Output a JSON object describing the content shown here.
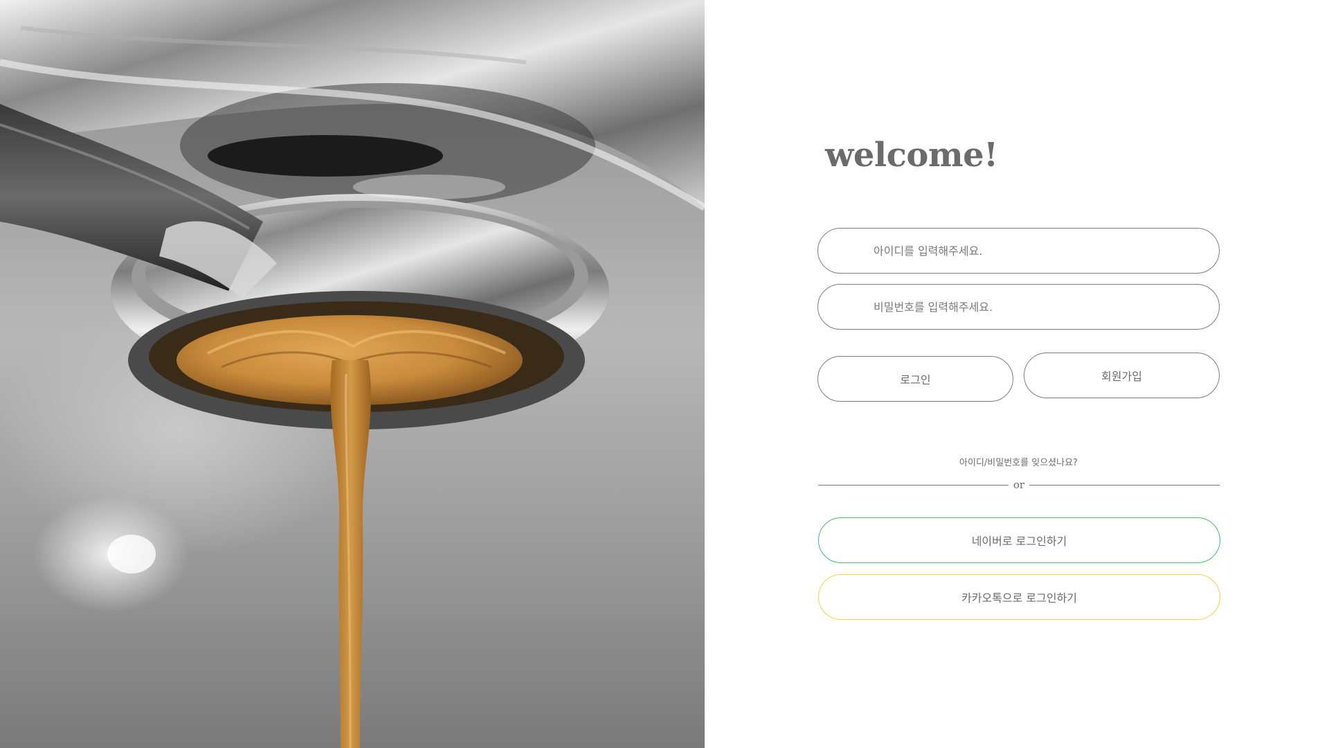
{
  "login": {
    "title": "welcome!",
    "id_placeholder": "아이디를 입력해주세요.",
    "password_placeholder": "비밀번호를 입력해주세요.",
    "login_label": "로그인",
    "signup_label": "회원가입",
    "forgot_label": "아이디/비밀번호를 잊으셨나요?",
    "divider_label": "or",
    "naver_label": "네이버로 로그인하기",
    "kakao_label": "카카오톡으로 로그인하기"
  },
  "colors": {
    "text": "#6b6b6b",
    "border": "#7d7d7d",
    "naver": "#3fbf6a",
    "kakao": "#f0d640",
    "espresso": "#b77a2b"
  },
  "photo": {
    "subject": "espresso-pouring-from-portafilter"
  }
}
